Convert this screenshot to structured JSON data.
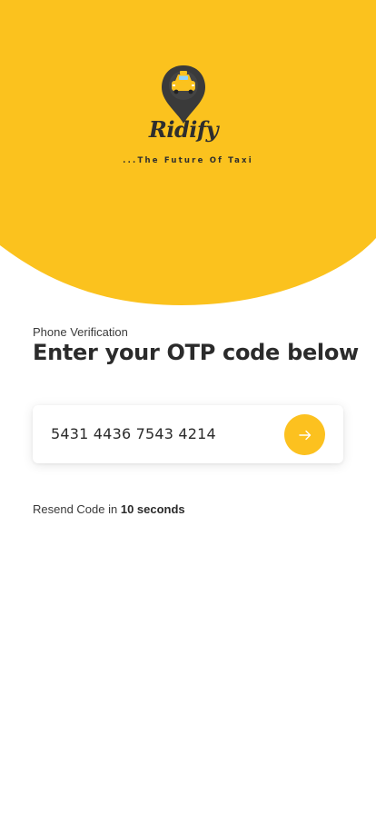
{
  "brand": {
    "name": "Ridify",
    "tagline": "...The Future Of Taxi"
  },
  "verification": {
    "subtitle": "Phone Verification",
    "title": "Enter your OTP code below",
    "otp_value": "5431 4436 7543 4214",
    "submit_icon": "arrow-right-icon"
  },
  "resend": {
    "prefix": "Resend Code in",
    "countdown": "10 seconds"
  },
  "colors": {
    "accent": "#fcc11f",
    "text_dark": "#2b2b2b",
    "background": "#ffffff"
  }
}
